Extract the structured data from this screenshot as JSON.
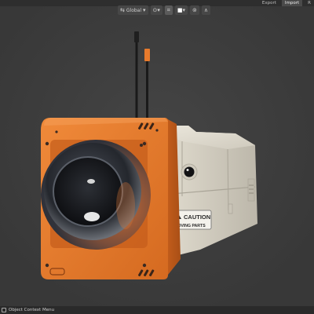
{
  "header": {
    "tabs": [
      {
        "label": "Export",
        "selected": false
      },
      {
        "label": "Import",
        "selected": true
      },
      {
        "label": "R",
        "selected": false
      }
    ]
  },
  "viewport_toolbar": {
    "orientation_label": "Global",
    "icons": [
      "transform-orientation-icon",
      "pivot-icon",
      "snap-icon",
      "snap-target-icon",
      "proportional-edit-icon",
      "falloff-icon"
    ]
  },
  "scene": {
    "label_line1": "CAUTION",
    "label_line2": "MOVING PARTS",
    "body_color": "#E4782A",
    "housing_color": "#D6D1C3",
    "background_color": "#3C3C3C"
  },
  "statusbar": {
    "text": "Object Context Menu"
  }
}
